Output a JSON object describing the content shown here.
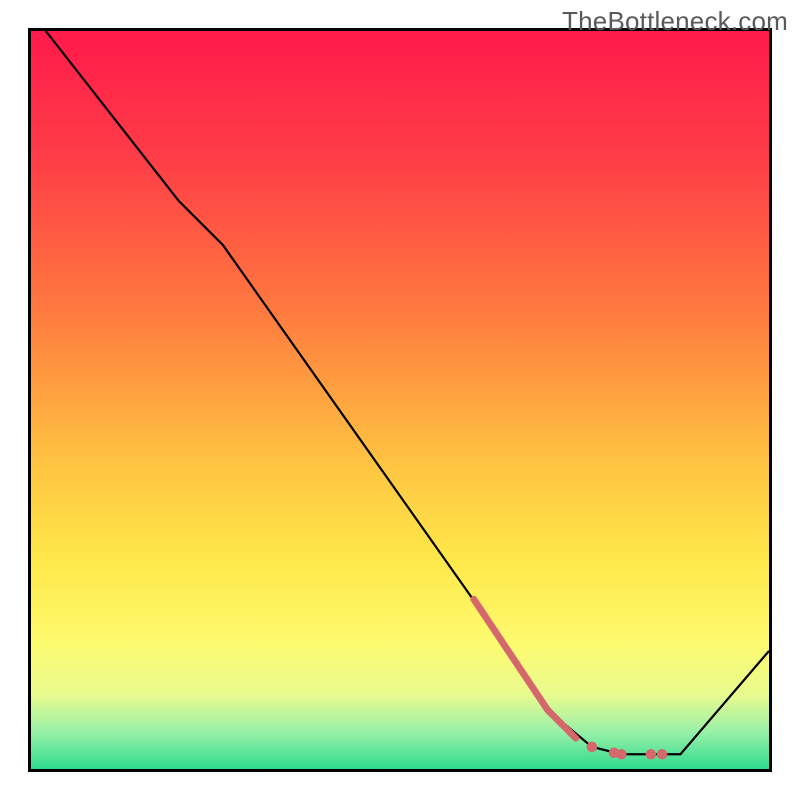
{
  "watermark": "TheBottleneck.com",
  "chart_data": {
    "type": "line",
    "title": "",
    "xlabel": "",
    "ylabel": "",
    "xlim": [
      0,
      100
    ],
    "ylim": [
      0,
      100
    ],
    "grid": false,
    "gradient_stops": [
      {
        "offset": 0,
        "color": "#ff1a4b"
      },
      {
        "offset": 18,
        "color": "#ff3f47"
      },
      {
        "offset": 38,
        "color": "#ff7a3f"
      },
      {
        "offset": 58,
        "color": "#ffc241"
      },
      {
        "offset": 72,
        "color": "#ffe94a"
      },
      {
        "offset": 83,
        "color": "#fdfb70"
      },
      {
        "offset": 90,
        "color": "#e8fb8f"
      },
      {
        "offset": 95,
        "color": "#98f0a8"
      },
      {
        "offset": 100,
        "color": "#2fdc8e"
      }
    ],
    "series": [
      {
        "name": "curve",
        "color": "#000000",
        "width": 2.2,
        "points": [
          {
            "x": 2,
            "y": 100
          },
          {
            "x": 20,
            "y": 77
          },
          {
            "x": 26,
            "y": 71
          },
          {
            "x": 62,
            "y": 20
          },
          {
            "x": 70,
            "y": 8
          },
          {
            "x": 76,
            "y": 3
          },
          {
            "x": 80,
            "y": 2
          },
          {
            "x": 88,
            "y": 2
          },
          {
            "x": 100,
            "y": 16
          }
        ]
      },
      {
        "name": "highlight",
        "color": "#d5686c",
        "width": 7,
        "dashed": true,
        "points": [
          {
            "x": 60,
            "y": 23
          },
          {
            "x": 70,
            "y": 8
          },
          {
            "x": 74,
            "y": 4
          }
        ]
      }
    ],
    "highlight_dots": {
      "color": "#d5686c",
      "radius": 5,
      "points": [
        {
          "x": 76,
          "y": 3
        },
        {
          "x": 79,
          "y": 2.2
        },
        {
          "x": 80,
          "y": 2
        },
        {
          "x": 84,
          "y": 2
        },
        {
          "x": 85.5,
          "y": 2
        }
      ]
    }
  }
}
